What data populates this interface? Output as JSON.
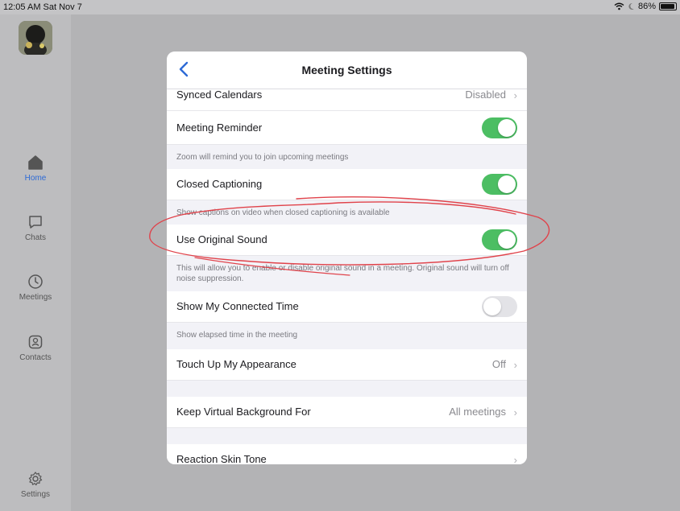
{
  "status_bar": {
    "time_date": "12:05 AM  Sat Nov 7",
    "battery": "86%",
    "battery_level": 0.86
  },
  "sidebar": {
    "items": [
      {
        "label": "Home",
        "icon": "home-icon",
        "active": true
      },
      {
        "label": "Chats",
        "icon": "chat-bubble-icon",
        "active": false
      },
      {
        "label": "Meetings",
        "icon": "clock-icon",
        "active": false
      },
      {
        "label": "Contacts",
        "icon": "contacts-icon",
        "active": false
      },
      {
        "label": "Settings",
        "icon": "gear-icon",
        "active": false
      }
    ]
  },
  "modal": {
    "title": "Meeting Settings",
    "rows": {
      "synced_calendars": {
        "label": "Synced Calendars",
        "value": "Disabled"
      },
      "meeting_reminder": {
        "label": "Meeting Reminder",
        "on": true,
        "desc": "Zoom will remind you to join upcoming meetings"
      },
      "closed_captioning": {
        "label": "Closed Captioning",
        "on": true,
        "desc": "Show captions on video when closed captioning is available"
      },
      "original_sound": {
        "label": "Use Original Sound",
        "on": true,
        "desc": "This will allow you to enable or disable original sound in a meeting. Original sound will turn off noise suppression."
      },
      "connected_time": {
        "label": "Show My Connected Time",
        "on": false,
        "desc": "Show elapsed time in the meeting"
      },
      "touch_up": {
        "label": "Touch Up My Appearance",
        "value": "Off"
      },
      "virtual_bg": {
        "label": "Keep Virtual Background For",
        "value": "All meetings"
      },
      "skin_tone": {
        "label": "Reaction Skin Tone"
      }
    }
  },
  "colors": {
    "accent": "#2d6ad6",
    "toggle_on": "#4cbe63",
    "annotation": "#e0424a"
  }
}
